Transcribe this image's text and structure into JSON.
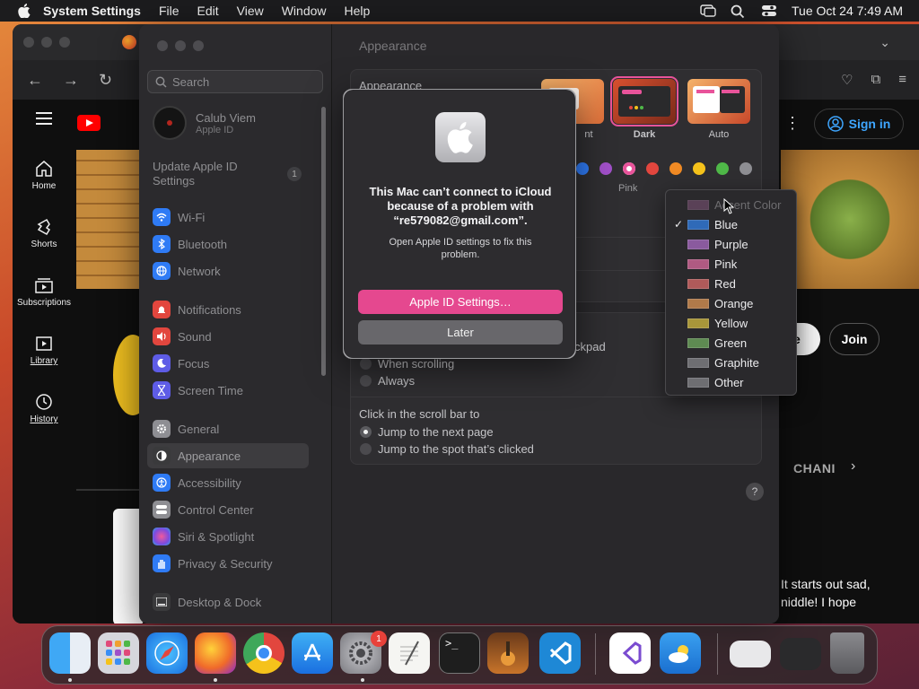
{
  "menubar": {
    "app_name": "System Settings",
    "menus": [
      "File",
      "Edit",
      "View",
      "Window",
      "Help"
    ],
    "clock": "Tue Oct 24  7:49 AM"
  },
  "browser": {
    "youtube_nav": [
      {
        "label": "Home",
        "icon": "home-icon"
      },
      {
        "label": "Shorts",
        "icon": "shorts-icon"
      },
      {
        "label": "Subscriptions",
        "icon": "subscriptions-icon"
      },
      {
        "label": "Library",
        "icon": "library-icon"
      },
      {
        "label": "History",
        "icon": "history-icon"
      }
    ],
    "sign_in": "Sign in",
    "subscribe_partial": "e",
    "join": "Join",
    "channel_tab": "CHANI",
    "comment_lines": [
      "It starts out sad,",
      "niddle! I hope"
    ]
  },
  "sidebar": {
    "search_placeholder": "Search",
    "user_name": "Calub Viem",
    "user_sub": "Apple ID",
    "update_label": "Update Apple ID Settings",
    "update_count": "1",
    "items": [
      {
        "label": "Wi-Fi",
        "color": "#2f7bf5",
        "icon": "wifi-icon"
      },
      {
        "label": "Bluetooth",
        "color": "#2f7bf5",
        "icon": "bluetooth-icon"
      },
      {
        "label": "Network",
        "color": "#2f7bf5",
        "icon": "network-icon"
      },
      {
        "label": "Notifications",
        "color": "#e2463e",
        "icon": "notifications-icon"
      },
      {
        "label": "Sound",
        "color": "#e2463e",
        "icon": "sound-icon"
      },
      {
        "label": "Focus",
        "color": "#5e5ce6",
        "icon": "focus-icon"
      },
      {
        "label": "Screen Time",
        "color": "#5e5ce6",
        "icon": "screen-time-icon"
      },
      {
        "label": "General",
        "color": "#8e8e93",
        "icon": "gear-icon"
      },
      {
        "label": "Appearance",
        "color": "#3a3a3c",
        "icon": "appearance-icon"
      },
      {
        "label": "Accessibility",
        "color": "#2f7bf5",
        "icon": "accessibility-icon"
      },
      {
        "label": "Control Center",
        "color": "#8e8e93",
        "icon": "control-center-icon"
      },
      {
        "label": "Siri & Spotlight",
        "color": "#c04bd6",
        "icon": "siri-icon"
      },
      {
        "label": "Privacy & Security",
        "color": "#2f7bf5",
        "icon": "hand-icon"
      },
      {
        "label": "Desktop & Dock",
        "color": "#3a3a3c",
        "icon": "dock-icon"
      }
    ],
    "selected": "Appearance"
  },
  "content": {
    "title": "Appearance",
    "appearance_label": "Appearance",
    "themes": [
      "nt",
      "Dark",
      "Auto"
    ],
    "selected_theme": "Dark",
    "accent_colors": [
      "#2f7bf5",
      "#a150c9",
      "#e8539a",
      "#e2463e",
      "#f08a24",
      "#f5c21b",
      "#4fb848",
      "#8e8e93"
    ],
    "accent_selected_label": "Pink",
    "trackpad_partial": "ckpad",
    "scroll_options": [
      "When scrolling",
      "Always"
    ],
    "click_scroll_label": "Click in the scroll bar to",
    "click_options": [
      "Jump to the next page",
      "Jump to the spot that’s clicked"
    ],
    "click_selected": 0,
    "help": "?"
  },
  "dialog": {
    "title": "This Mac can’t connect to iCloud because of a problem with “re579082@gmail.com”.",
    "message": "Open Apple ID settings to fix this problem.",
    "primary_button": "Apple ID Settings…",
    "secondary_button": "Later"
  },
  "accent_menu": {
    "header": "Accent Color",
    "checked": "Blue",
    "options": [
      {
        "label": "Blue",
        "color": "#2f6ab8"
      },
      {
        "label": "Purple",
        "color": "#8a5a9e"
      },
      {
        "label": "Pink",
        "color": "#b05a82"
      },
      {
        "label": "Red",
        "color": "#b05a5a"
      },
      {
        "label": "Orange",
        "color": "#b07a4a"
      },
      {
        "label": "Yellow",
        "color": "#a8963a"
      },
      {
        "label": "Green",
        "color": "#5e8a52"
      },
      {
        "label": "Graphite",
        "color": "#6e6e72"
      },
      {
        "label": "Other",
        "color": "#6e6e72"
      }
    ]
  },
  "dock": {
    "apps": [
      "finder",
      "launchpad",
      "safari",
      "firefox",
      "chrome",
      "app-store",
      "system-settings",
      "textedit",
      "terminal",
      "instruments",
      "vscode",
      "visual-studio",
      "weather",
      "preview-window",
      "chrome-window",
      "trash"
    ],
    "settings_badge": "1"
  }
}
